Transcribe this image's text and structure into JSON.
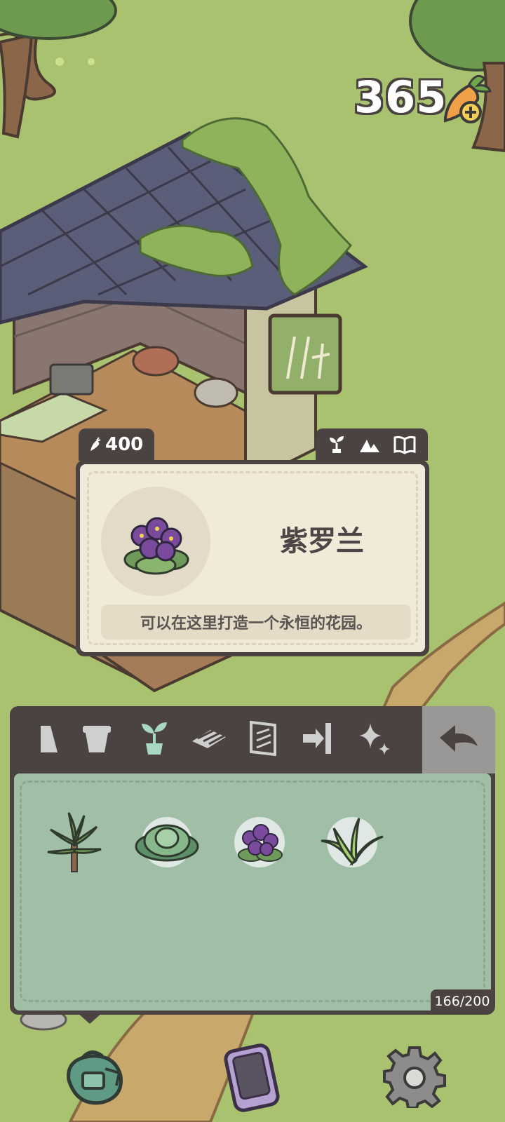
{
  "hud": {
    "currency_amount": "365",
    "currency_icon": "carrot-add-icon"
  },
  "info_card": {
    "price": "400",
    "price_icon": "carrot-icon",
    "tags": [
      "sprout-icon",
      "mountain-icon",
      "book-icon"
    ],
    "item_name": "紫罗兰",
    "item_description": "可以在这里打造一个永恒的花园。",
    "item_icon": "violet-flower-icon"
  },
  "inventory": {
    "categories": [
      {
        "id": "partial",
        "icon": "partial-category-icon",
        "selected": false
      },
      {
        "id": "pots",
        "icon": "pot-icon",
        "selected": false
      },
      {
        "id": "plants",
        "icon": "sprout-icon",
        "selected": true
      },
      {
        "id": "floors",
        "icon": "planks-icon",
        "selected": false
      },
      {
        "id": "wallpaper",
        "icon": "wallpaper-icon",
        "selected": false
      },
      {
        "id": "doors",
        "icon": "door-arrow-icon",
        "selected": false
      },
      {
        "id": "effects",
        "icon": "sparkle-icon",
        "selected": false
      }
    ],
    "back_icon": "back-arrow-icon",
    "items": [
      {
        "icon": "dracaena-plant-icon"
      },
      {
        "icon": "succulent-plant-icon"
      },
      {
        "icon": "violet-flower-icon"
      },
      {
        "icon": "grass-plant-icon"
      }
    ],
    "capacity": "166/200"
  },
  "bottom_bar": {
    "buttons": [
      "backpack-icon",
      "phone-icon",
      "gear-icon"
    ]
  },
  "colors": {
    "panel_dark": "#4b4342",
    "card_bg": "#f2ead8",
    "grid_bg": "#a1bfa7",
    "grass": "#a9c26f",
    "selected_tab": "#a8d8c2"
  }
}
